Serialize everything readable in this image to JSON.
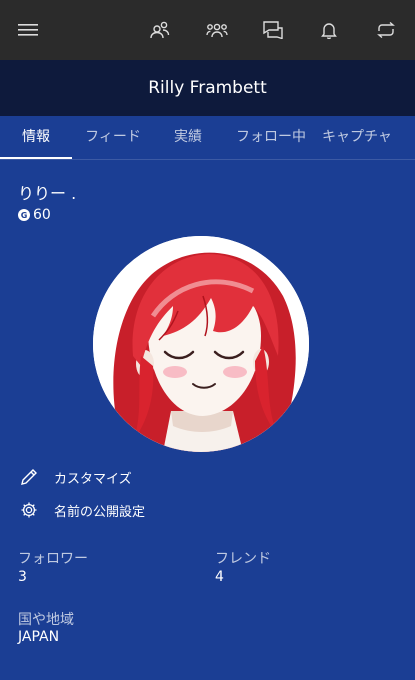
{
  "toolbar": {
    "menu_icon": "hamburger-menu-icon",
    "icons": [
      "friends-icon",
      "party-icon",
      "messages-icon",
      "notifications-icon",
      "sync-icon"
    ]
  },
  "profile_header": {
    "name": "Rilly Frambett"
  },
  "tabs": [
    {
      "label": "情報",
      "active": true
    },
    {
      "label": "フィード",
      "active": false
    },
    {
      "label": "実績",
      "active": false
    },
    {
      "label": "フォロー中",
      "active": false
    },
    {
      "label": "キャプチャ",
      "active": false
    }
  ],
  "profile": {
    "gamertag": "りりー .",
    "gamerscore_badge": "G",
    "gamerscore": "60"
  },
  "actions": {
    "customize": "カスタマイズ",
    "name_privacy": "名前の公開設定"
  },
  "stats": {
    "followers_label": "フォロワー",
    "followers_value": "3",
    "friends_label": "フレンド",
    "friends_value": "4",
    "region_label": "国や地域",
    "region_value": "JAPAN"
  },
  "colors": {
    "background": "#1b3e94",
    "toolbar": "#2b2b2b",
    "titlebar": "#0e1a3c",
    "avatar_hair": "#d9232e"
  }
}
